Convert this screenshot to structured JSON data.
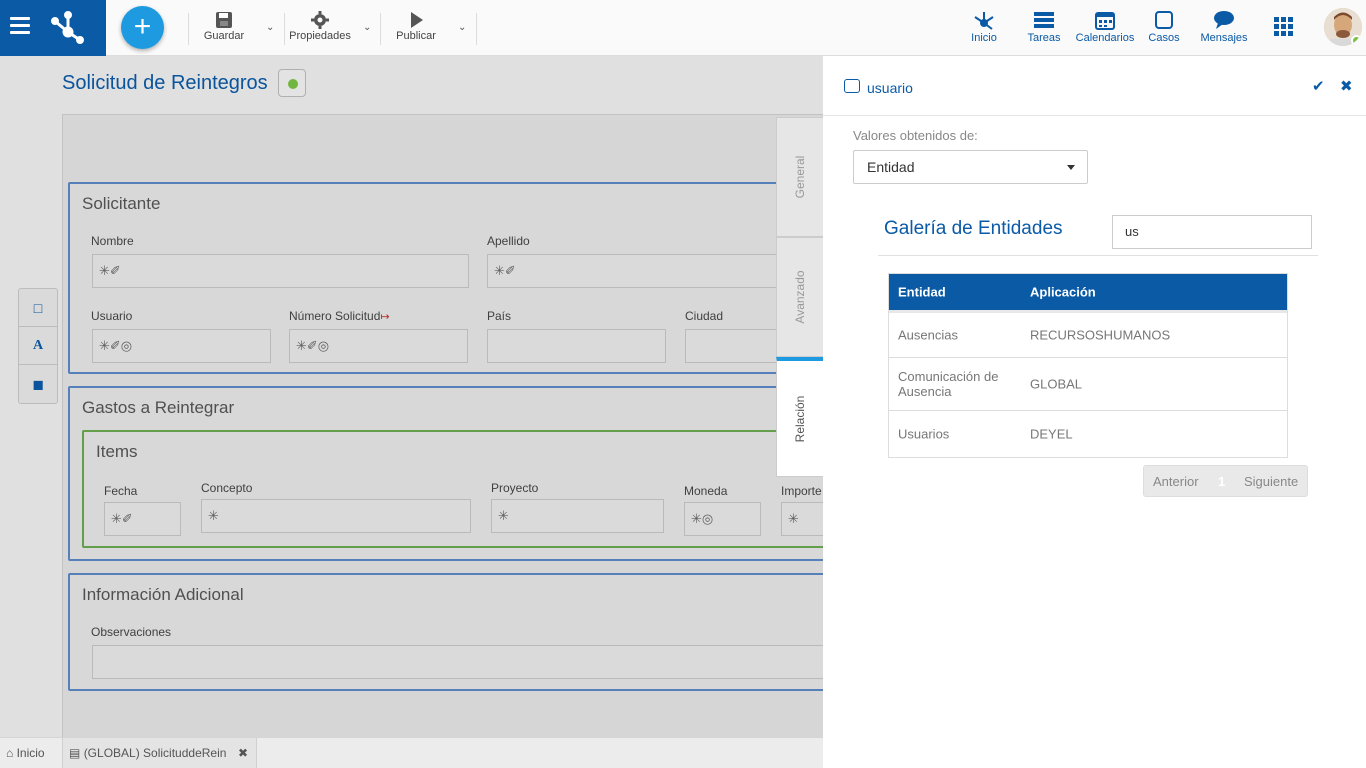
{
  "toolbar": {
    "save": "Guardar",
    "properties": "Propiedades",
    "publish": "Publicar"
  },
  "nav": {
    "home": "Inicio",
    "tasks": "Tareas",
    "calendars": "Calendarios",
    "cases": "Casos",
    "messages": "Mensajes"
  },
  "form": {
    "title": "Solicitud de Reintegros",
    "sections": {
      "solicitante": "Solicitante",
      "gastos": "Gastos a Reintegrar",
      "items": "Items",
      "info": "Información Adicional"
    },
    "fields": {
      "nombre": "Nombre",
      "apellido": "Apellido",
      "usuario": "Usuario",
      "numero_solicitud": "Número Solicitud",
      "pais": "País",
      "ciudad": "Ciudad",
      "fecha": "Fecha",
      "concepto": "Concepto",
      "proyecto": "Proyecto",
      "moneda": "Moneda",
      "importe": "Importe",
      "observaciones": "Observaciones"
    },
    "field_markers": {
      "nombre": "✳✐",
      "apellido": "✳✐",
      "usuario": "✳✐◎",
      "numero_solicitud": "✳✐◎",
      "fecha": "✳✐",
      "concepto": "✳",
      "proyecto": "✳",
      "moneda": "✳◎",
      "importe": "✳"
    }
  },
  "vtabs": {
    "general": "General",
    "advanced": "Avanzado",
    "relation": "Relación"
  },
  "panel": {
    "title": "usuario",
    "source_label": "Valores obtenidos de:",
    "source_value": "Entidad",
    "gallery_title": "Galería de Entidades",
    "search_value": "us",
    "table": {
      "headers": [
        "Entidad",
        "Aplicación"
      ],
      "rows": [
        [
          "Ausencias",
          "RECURSOSHUMANOS"
        ],
        [
          "Comunicación de Ausencia",
          "GLOBAL"
        ],
        [
          "Usuarios",
          "DEYEL"
        ]
      ]
    },
    "pager": {
      "prev": "Anterior",
      "page": "1",
      "next": "Siguiente"
    }
  },
  "bottom_tabs": {
    "home": "Inicio",
    "doc": "(GLOBAL) SolicituddeRein"
  },
  "colors": {
    "brand": "#0a5aa6",
    "accent": "#1e9be0",
    "status_green": "#7ac143"
  }
}
